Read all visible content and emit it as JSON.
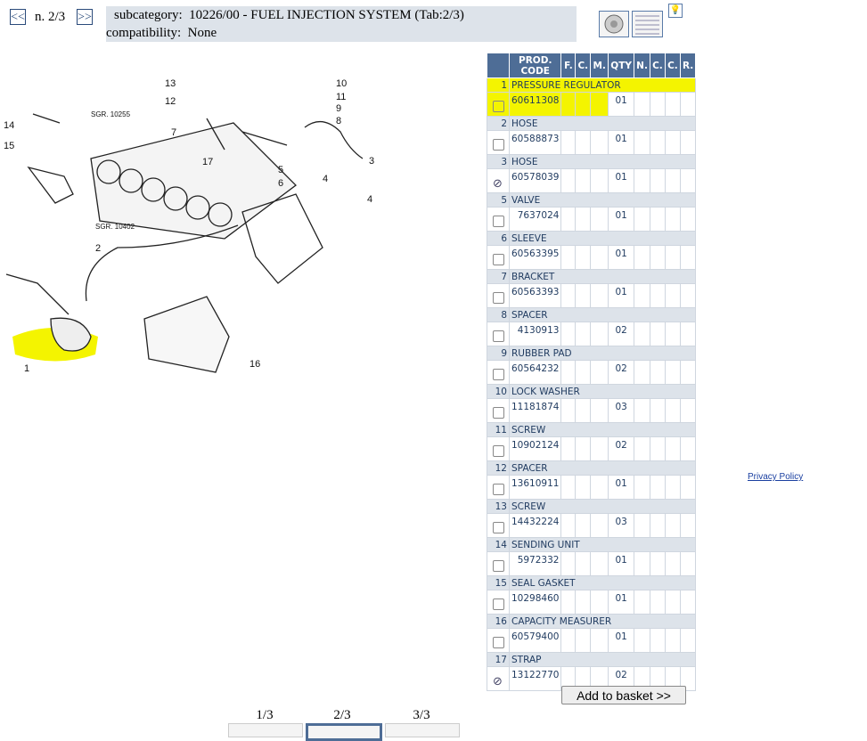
{
  "nav": {
    "prev": "<<",
    "next": ">>",
    "page": "n. 2/3"
  },
  "info": {
    "subcategory_label": "subcategory:",
    "subcategory": "10226/00 - FUEL INJECTION SYSTEM (Tab:2/3)",
    "compat_label": "compatibility:",
    "compat": "None"
  },
  "diagram": {
    "labels": [
      "13",
      "12",
      "10",
      "11",
      "9",
      "8",
      "14",
      "15",
      "7",
      "SGR. 10255",
      "17",
      "5",
      "6",
      "3",
      "4",
      "4",
      "SGR. 10402",
      "2",
      "1",
      "16"
    ],
    "highlight_color": "#f4f400"
  },
  "table": {
    "headers": [
      "PROD. CODE",
      "F.",
      "C.",
      "M.",
      "QTY",
      "N.",
      "C.",
      "C.",
      "R."
    ],
    "items": [
      {
        "n": "1",
        "name": "PRESSURE REGULATOR",
        "code": "60611308",
        "qty": "01",
        "state": "unchecked",
        "highlight": true
      },
      {
        "n": "2",
        "name": "HOSE",
        "code": "60588873",
        "qty": "01",
        "state": "unchecked"
      },
      {
        "n": "3",
        "name": "HOSE",
        "code": "60578039",
        "qty": "01",
        "state": "disabled"
      },
      {
        "n": "5",
        "name": "VALVE",
        "code": "7637024",
        "qty": "01",
        "state": "unchecked"
      },
      {
        "n": "6",
        "name": "SLEEVE",
        "code": "60563395",
        "qty": "01",
        "state": "unchecked"
      },
      {
        "n": "7",
        "name": "BRACKET",
        "code": "60563393",
        "qty": "01",
        "state": "unchecked"
      },
      {
        "n": "8",
        "name": "SPACER",
        "code": "4130913",
        "qty": "02",
        "state": "unchecked"
      },
      {
        "n": "9",
        "name": "RUBBER PAD",
        "code": "60564232",
        "qty": "02",
        "state": "unchecked"
      },
      {
        "n": "10",
        "name": "LOCK WASHER",
        "code": "11181874",
        "qty": "03",
        "state": "unchecked"
      },
      {
        "n": "11",
        "name": "SCREW",
        "code": "10902124",
        "qty": "02",
        "state": "unchecked"
      },
      {
        "n": "12",
        "name": "SPACER",
        "code": "13610911",
        "qty": "01",
        "state": "unchecked"
      },
      {
        "n": "13",
        "name": "SCREW",
        "code": "14432224",
        "qty": "03",
        "state": "unchecked"
      },
      {
        "n": "14",
        "name": "SENDING UNIT",
        "code": "5972332",
        "qty": "01",
        "state": "unchecked"
      },
      {
        "n": "15",
        "name": "SEAL GASKET",
        "code": "10298460",
        "qty": "01",
        "state": "unchecked"
      },
      {
        "n": "16",
        "name": "CAPACITY MEASURER",
        "code": "60579400",
        "qty": "01",
        "state": "unchecked"
      },
      {
        "n": "17",
        "name": "STRAP",
        "code": "13122770",
        "qty": "02",
        "state": "disabled"
      }
    ]
  },
  "basket_label": "Add to basket >>",
  "privacy": "Privacy Policy",
  "tabs": [
    "1/3",
    "2/3",
    "3/3"
  ],
  "colors": {
    "header": "#4e6d96",
    "row": "#dde3ea",
    "accent": "#1f3a5f"
  }
}
